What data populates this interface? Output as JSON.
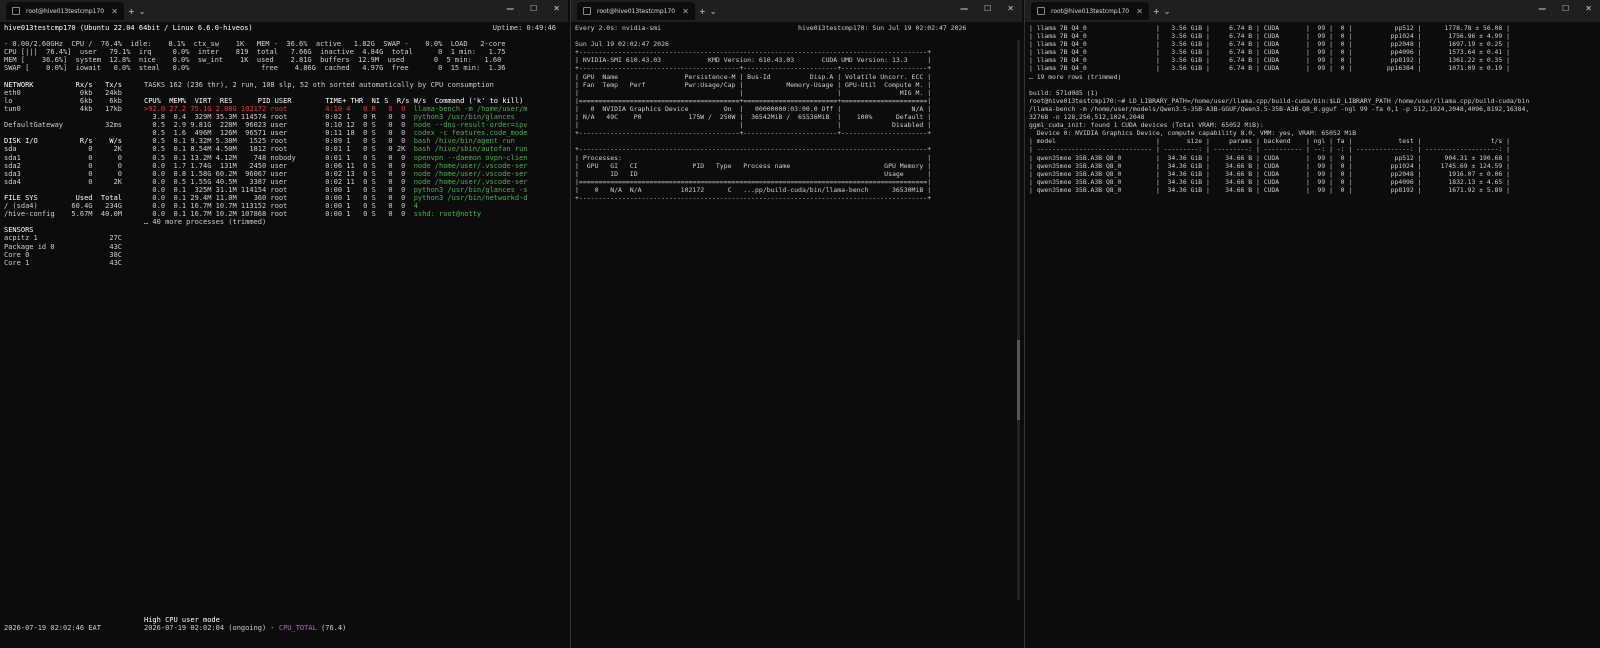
{
  "pane1": {
    "tab_title": "root@hive013testcmp170",
    "window_controls": [
      "—",
      "☐",
      "✕"
    ],
    "header_left": "hive013testcmp170 (Ubuntu 22.04 64bit / Linux 6.6.0-hiveos)",
    "header_right": "Uptime: 0:49:46",
    "cpu_summary": [
      "- 0.00/2.60GHz  CPU /  76.4%  idle:    8.1%  ctx_sw    1K   MEM -  36.6%  active   1.82G  SWAP -    0.0%  LOAD   2-core",
      "CPU [|||  76.4%]  user   79.1%  irq     0.0%  inter    819  total   7.66G  inactive  4.84G  total      0  1 min:   1.75",
      "MEM [    36.6%]  system  12.8%  nice    0.0%  sw_int    1K  used    2.81G  buffers  12.9M  used       0  5 min:   1.60",
      "SWAP [    0.0%]  iowait   0.0%  steal   0.0%                 free    4.86G  cached   4.97G  free       0  15 min:  1.36"
    ],
    "left_col": [
      "NETWORK          Rx/s   Tx/s",
      "eth0              0kb   24kb",
      "lo                6kb    6kb",
      "tun0              4kb   17kb",
      "",
      "DefaultGateway          32ms",
      "",
      "DISK I/O          R/s    W/s",
      "sda                 0     2K",
      "sda1                0      0",
      "sda2                0      0",
      "sda3                0      0",
      "sda4                0     2K",
      "",
      "FILE SYS         Used  Total",
      "/ (sda4)        60.4G   234G",
      "/hive-config    5.67M  40.0M",
      "",
      "SENSORS",
      "acpitz 1                 27C",
      "Package id 0             43C",
      "Core 0                   38C",
      "Core 1                   43C"
    ],
    "tasks_line": "TASKS 162 (236 thr), 2 run, 108 slp, 52 oth sorted automatically by CPU consumption",
    "proc_header": "CPU%  MEM%  VIRT  RES      PID USER        TIME+ THR  NI S  R/s W/s  Command ('k' to kill)",
    "procs": [
      [
        ">92.0 27.2 75.1G 2.08G 102172 root         4:10 4   0 R   0  0  ",
        "llama-bench -m /home/user/m"
      ],
      [
        "  3.8  0.4  329M 35.3M 114574 root         0:02 1   0 R   0  0  ",
        "python3 /usr/bin/glances"
      ],
      [
        "  0.5  2.9 9.81G  228M  96023 user         0:10 12  0 S   0  0  ",
        "node --dns-result-order=ipv"
      ],
      [
        "  0.5  1.6  496M  126M  96571 user         0:11 18  0 S   0  0  ",
        "codex -c features.code_mode"
      ],
      [
        "  0.5  0.1 9.32M 5.38M   1525 root         0:09 1   0 S   0  0  ",
        "bash /hive/bin/agent run"
      ],
      [
        "  0.5  0.1 8.54M 4.50M   1812 root         0:01 1   0 S   0 2K  ",
        "bash /hive/sbin/autofan run"
      ],
      [
        "  0.5  0.1 13.2M 4.12M    748 nobody       0:01 1   0 S   0  0  ",
        "openvpn --daemon ovpn-clien"
      ],
      [
        "  0.0  1.7 1.74G  131M   2450 user         0:06 11  0 S   0  0  ",
        "node /home/user/.vscode-ser"
      ],
      [
        "  0.0  0.8 1.58G 60.2M  96067 user         0:02 13  0 S   0  0  ",
        "node /home/user/.vscode-ser"
      ],
      [
        "  0.0  0.5 1.55G 40.5M   3387 user         0:02 11  0 S   0  0  ",
        "node /home/user/.vscode-ser"
      ],
      [
        "  0.0  0.1  325M 31.1M 114154 root         0:00 1   0 S   0  0  ",
        "python3 /usr/bin/glances -s"
      ],
      [
        "  0.0  0.1 29.4M 11.0M    360 root         0:00 1   0 S   0  0  ",
        "python3 /usr/bin/networkd-d"
      ],
      [
        "  0.0  0.1 16.7M 10.7M 113152 root         0:00 1   0 S   0  0  ",
        "4"
      ],
      [
        "  0.0  0.1 16.7M 10.2M 107868 root         0:00 1   0 S   0  0  ",
        "sshd: root@notty"
      ]
    ],
    "proc_more": "… 40 more processes (trimmed)",
    "footer_time": "2026-07-19 02:02:46 EAT",
    "alert_title": "High CPU user mode",
    "alert_line_a": "2026-07-19 02:02:04 (ongoing) - ",
    "alert_line_b": "CPU_TOTAL",
    "alert_line_c": " (76.4)"
  },
  "pane2": {
    "tab_title": "root@hive013testcmp170",
    "window_controls": [
      "—",
      "☐",
      "✕"
    ],
    "lines": [
      "Every 2.0s: nvidia-smi                                   hive013testcmp170: Sun Jul 19 02:02:47 2026",
      "",
      "Sun Jul 19 02:02:47 2026",
      "+-----------------------------------------------------------------------------------------+",
      "| NVIDIA-SMI 610.43.03            KMD Version: 610.43.03       CUDA UMD Version: 13.3     |",
      "+-----------------------------------------+------------------------+----------------------+",
      "| GPU  Name                 Persistence-M | Bus-Id          Disp.A | Volatile Uncorr. ECC |",
      "| Fan  Temp   Perf          Pwr:Usage/Cap |           Memory-Usage | GPU-Util  Compute M. |",
      "|                                         |                        |               MIG M. |",
      "|=========================================+========================+======================|",
      "|   0  NVIDIA Graphics Device         On  |   00000000:03:00.0 Off |                  N/A |",
      "| N/A   49C    P0            175W /  250W |  36542MiB /  65536MiB  |    100%      Default |",
      "|                                         |                        |             Disabled |",
      "+-----------------------------------------+------------------------+----------------------+",
      "",
      "+-----------------------------------------------------------------------------------------+",
      "| Processes:                                                                              |",
      "|  GPU   GI   CI              PID   Type   Process name                        GPU Memory |",
      "|        ID   ID                                                               Usage      |",
      "|=========================================================================================|",
      "|    0   N/A  N/A          102172      C   ...pp/build-cuda/bin/llama-bench      36530MiB |",
      "+-----------------------------------------------------------------------------------------+"
    ]
  },
  "pane3": {
    "tab_title": "root@hive013testcmp170",
    "window_controls": [
      "—",
      "☐",
      "✕"
    ],
    "bench_rows": [
      [
        "llama 7B Q4_0",
        "3.56 GiB",
        "6.74 B",
        "CUDA",
        "99",
        "0",
        "pp512",
        "1778.78 ± 56.08"
      ],
      [
        "llama 7B Q4_0",
        "3.56 GiB",
        "6.74 B",
        "CUDA",
        "99",
        "0",
        "pp1024",
        "1756.96 ± 4.99"
      ],
      [
        "llama 7B Q4_0",
        "3.56 GiB",
        "6.74 B",
        "CUDA",
        "99",
        "0",
        "pp2048",
        "1697.19 ± 0.25"
      ],
      [
        "llama 7B Q4_0",
        "3.56 GiB",
        "6.74 B",
        "CUDA",
        "99",
        "0",
        "pp4096",
        "1573.64 ± 0.41"
      ],
      [
        "llama 7B Q4_0",
        "3.56 GiB",
        "6.74 B",
        "CUDA",
        "99",
        "0",
        "pp8192",
        "1361.22 ± 0.35"
      ],
      [
        "llama 7B Q4_0",
        "3.56 GiB",
        "6.74 B",
        "CUDA",
        "99",
        "0",
        "pp16384",
        "1071.09 ± 0.19"
      ]
    ],
    "bench_more": "… 19 more rows (trimmed)",
    "after": [
      "",
      "build: 571d0d5 (1)",
      "root@hive013testcmp170:~# LD_LIBRARY_PATH=/home/user/llama.cpp/build-cuda/bin:$LD_LIBRARY_PATH /home/user/llama.cpp/build-cuda/bin",
      "/llama-bench -m /home/user/models/Qwen3.5-35B-A3B-GGUF/Qwen3.5-35B-A3B-Q8_0.gguf -ngl 99 -fa 0,1 -p 512,1024,2048,4096,8192,16384,",
      "32768 -n 128,256,512,1024,2048",
      "ggml_cuda_init: found 1 CUDA devices (Total VRAM: 65052 MiB):",
      "  Device 0: NVIDIA Graphics Device, compute capability 8.0, VMM: yes, VRAM: 65052 MiB",
      "| model                          |       size |     params | backend    | ngl | fa |            test |                  t/s |",
      "| ------------------------------ | ---------: | ---------: | ---------- | --: | -: | --------------: | -------------------: |"
    ],
    "qwen_rows": [
      [
        "qwen35moe 35B.A3B Q8_0",
        "34.36 GiB",
        "34.66 B",
        "CUDA",
        "99",
        "0",
        "pp512",
        "904.31 ± 190.68"
      ],
      [
        "qwen35moe 35B.A3B Q8_0",
        "34.36 GiB",
        "34.66 B",
        "CUDA",
        "99",
        "0",
        "pp1024",
        "1745.69 ± 124.59"
      ],
      [
        "qwen35moe 35B.A3B Q8_0",
        "34.36 GiB",
        "34.66 B",
        "CUDA",
        "99",
        "0",
        "pp2048",
        "1916.07 ± 0.06"
      ],
      [
        "qwen35moe 35B.A3B Q8_0",
        "34.36 GiB",
        "34.66 B",
        "CUDA",
        "99",
        "0",
        "pp4096",
        "1832.13 ± 4.65"
      ],
      [
        "qwen35moe 35B.A3B Q8_0",
        "34.36 GiB",
        "34.66 B",
        "CUDA",
        "99",
        "0",
        "pp8192",
        "1671.92 ± 5.89"
      ]
    ]
  }
}
